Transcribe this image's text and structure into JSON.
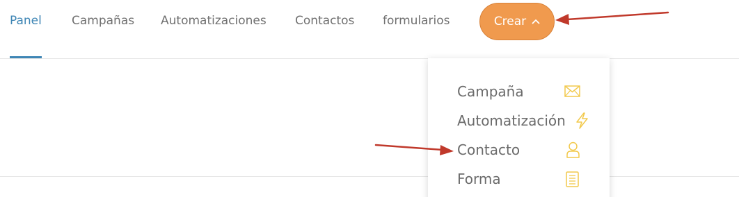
{
  "nav": {
    "items": [
      {
        "label": "Panel"
      },
      {
        "label": "Campañas"
      },
      {
        "label": "Automatizaciones"
      },
      {
        "label": "Contactos"
      },
      {
        "label": "formularios"
      }
    ],
    "active_index": 0,
    "create_button": {
      "label": "Crear",
      "icon": "chevron-up-icon"
    }
  },
  "menu": {
    "items": [
      {
        "label": "Campaña",
        "icon": "envelope-icon"
      },
      {
        "label": "Automatización",
        "icon": "lightning-icon"
      },
      {
        "label": "Contacto",
        "icon": "person-icon"
      },
      {
        "label": "Forma",
        "icon": "document-icon"
      }
    ]
  },
  "annotations": {
    "arrows": [
      "arrow-to-crear-button",
      "arrow-to-contacto-item"
    ],
    "arrow_color": "#c0392b"
  },
  "colors": {
    "active": "#3f86b5",
    "nav_text": "#707070",
    "button_bg": "#f09a4e",
    "icon_yellow": "#f2c94c",
    "menu_text": "#6b6b6b"
  }
}
